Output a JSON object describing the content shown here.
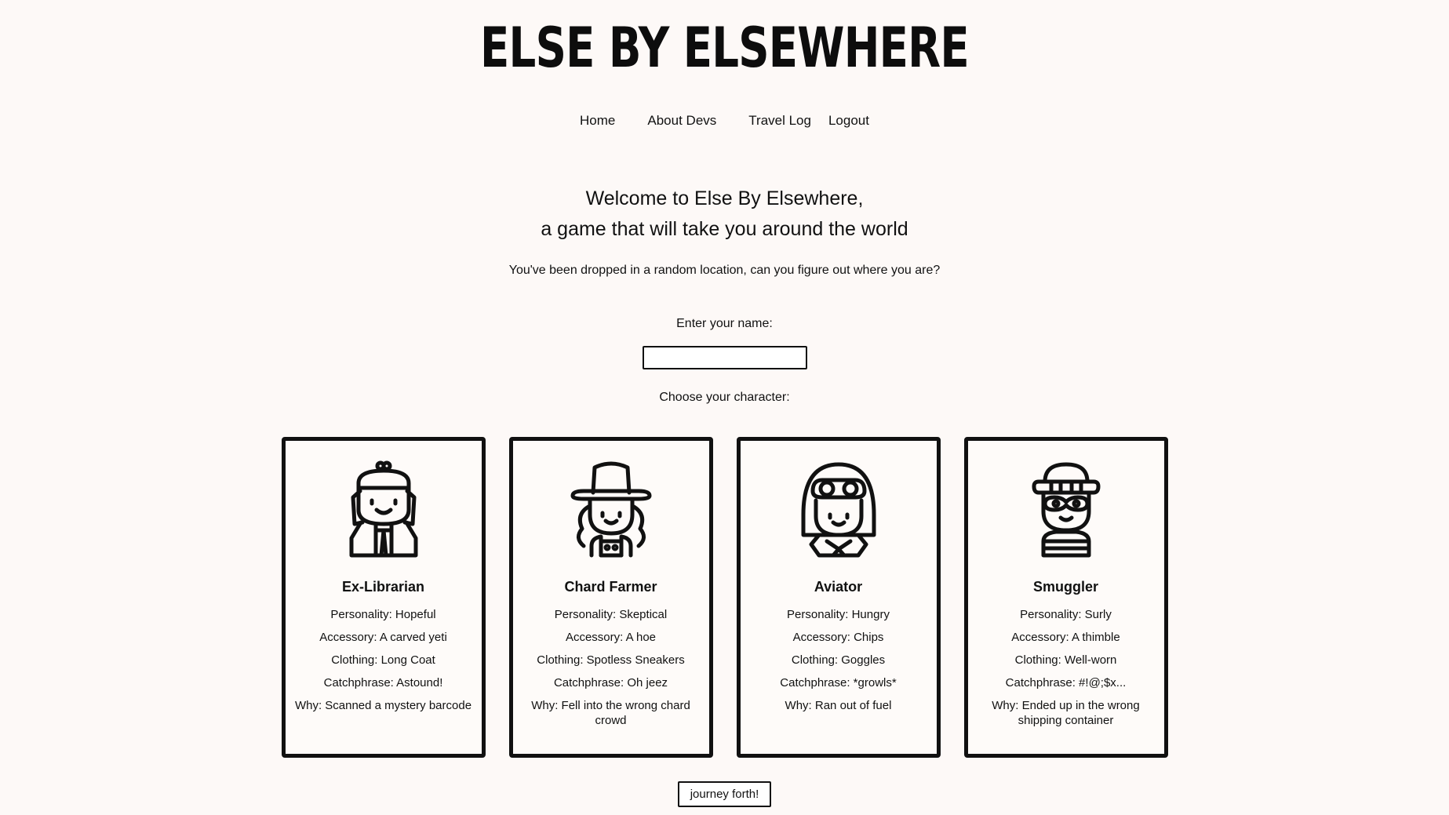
{
  "header": {
    "title": "ELSE BY ELSEWHERE"
  },
  "nav": {
    "home": "Home",
    "about": "About Devs",
    "travel_log": "Travel Log",
    "logout": "Logout"
  },
  "main": {
    "welcome_line1": "Welcome to Else By Elsewhere,",
    "welcome_line2": "a game that will take you around the world",
    "subtitle": "You've been dropped in a random location, can you figure out where you are?",
    "name_label": "Enter your name:",
    "name_value": "",
    "choose_label": "Choose your character:",
    "submit_label": "journey forth!"
  },
  "characters": [
    {
      "icon": "librarian-avatar-icon",
      "name": "Ex-Librarian",
      "personality": "Personality: Hopeful",
      "accessory": "Accessory: A carved yeti",
      "clothing": "Clothing: Long Coat",
      "catchphrase": "Catchphrase: Astound!",
      "why": "Why: Scanned a mystery barcode"
    },
    {
      "icon": "farmer-avatar-icon",
      "name": "Chard Farmer",
      "personality": "Personality: Skeptical",
      "accessory": "Accessory: A hoe",
      "clothing": "Clothing: Spotless Sneakers",
      "catchphrase": "Catchphrase: Oh jeez",
      "why": "Why: Fell into the wrong chard crowd"
    },
    {
      "icon": "aviator-avatar-icon",
      "name": "Aviator",
      "personality": "Personality: Hungry",
      "accessory": "Accessory: Chips",
      "clothing": "Clothing: Goggles",
      "catchphrase": "Catchphrase: *growls*",
      "why": "Why: Ran out of fuel"
    },
    {
      "icon": "smuggler-avatar-icon",
      "name": "Smuggler",
      "personality": "Personality: Surly",
      "accessory": "Accessory: A thimble",
      "clothing": "Clothing: Well-worn",
      "catchphrase": "Catchphrase: #!@;$x...",
      "why": "Why: Ended up in the wrong shipping container"
    }
  ]
}
